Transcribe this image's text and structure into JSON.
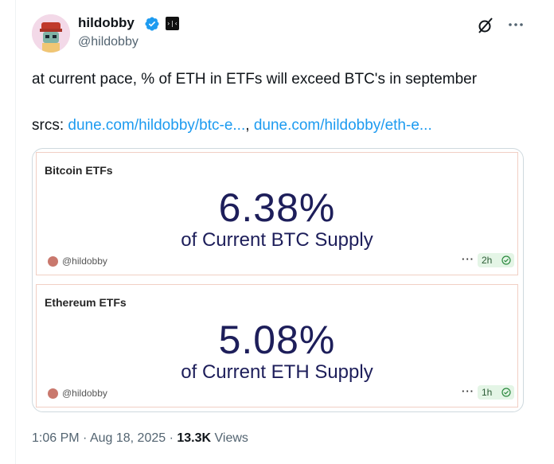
{
  "author": {
    "name": "hildobby",
    "handle": "@hildobby",
    "verified_color": "#1d9bf0"
  },
  "tweet": {
    "text": "at current pace, % of ETH in ETFs will exceed BTC's in september",
    "srcs_prefix": "srcs: ",
    "link1": "dune.com/hildobby/btc-e...",
    "separator": ",",
    "link2": "dune.com/hildobby/eth-e..."
  },
  "cards": [
    {
      "title": "Bitcoin ETFs",
      "value": "6.38%",
      "subtitle": "of Current BTC Supply",
      "handle": "@hildobby",
      "dots": "···",
      "age": "2h"
    },
    {
      "title": "Ethereum ETFs",
      "value": "5.08%",
      "subtitle": "of Current ETH Supply",
      "handle": "@hildobby",
      "dots": "···",
      "age": "1h"
    }
  ],
  "footer": {
    "time": "1:06 PM",
    "dot1": " · ",
    "date": "Aug 18, 2025",
    "dot2": " · ",
    "views_count": "13.3K",
    "views_label": " Views"
  },
  "icons": {
    "avatar": "avatar-icon",
    "verified": "verified-badge-icon",
    "affiliate": "affiliate-badge-icon",
    "grok": "grok-icon",
    "more": "more-options-icon"
  },
  "colors": {
    "link": "#1d9bf0",
    "metric": "#1d1e5a",
    "card_border": "#f1cfc4"
  }
}
